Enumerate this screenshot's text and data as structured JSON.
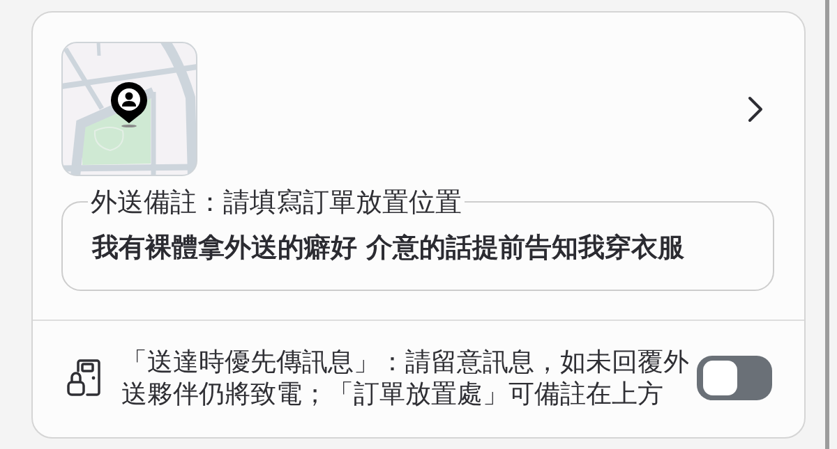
{
  "delivery_note": {
    "label": "外送備註：請填寫訂單放置位置",
    "value": "我有裸體拿外送的癖好 介意的話提前告知我穿衣服"
  },
  "message_first": {
    "text": "「送達時優先傳訊息」：請留意訊息，如未回覆外送夥伴仍將致電；「訂單放置處」可備註在上方",
    "on": false
  }
}
